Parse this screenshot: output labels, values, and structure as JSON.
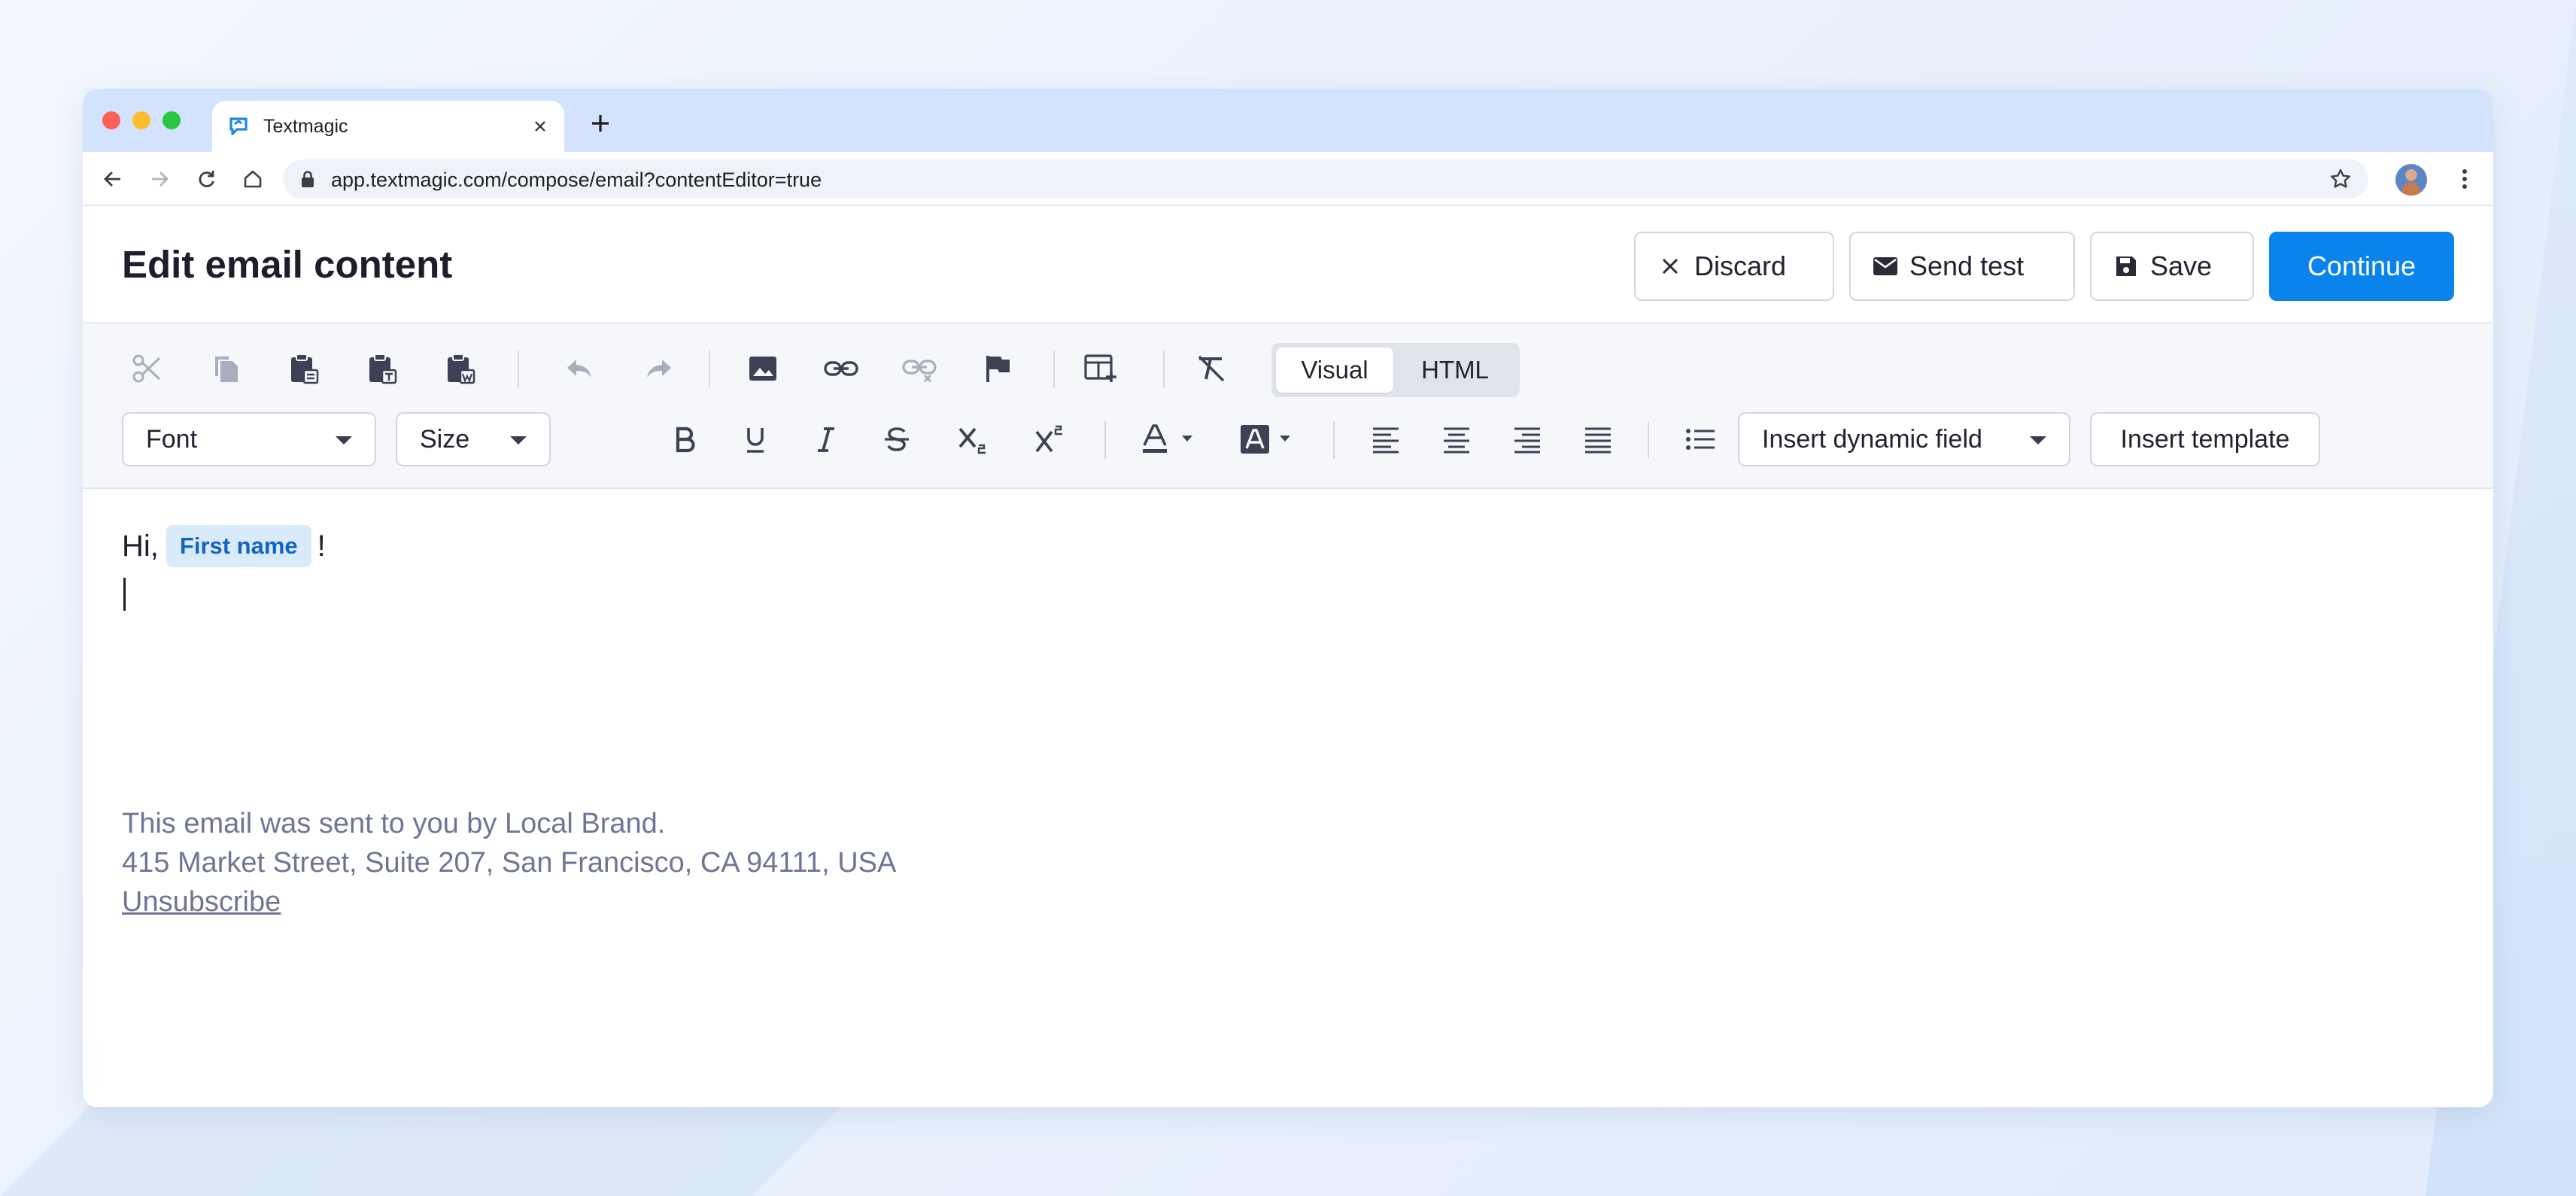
{
  "browser": {
    "tab_title": "Textmagic",
    "url": "app.textmagic.com/compose/email?contentEditor=true"
  },
  "header": {
    "title": "Edit email content",
    "discard_label": "Discard",
    "send_test_label": "Send test",
    "save_label": "Save",
    "continue_label": "Continue"
  },
  "toolbar": {
    "mode_visual": "Visual",
    "mode_html": "HTML",
    "font_select": "Font",
    "size_select": "Size",
    "dynamic_field_select": "Insert dynamic field",
    "insert_template_label": "Insert template",
    "icons_row1": [
      "cut-icon",
      "copy-icon",
      "paste-icon",
      "paste-text-icon",
      "paste-word-icon",
      "undo-icon",
      "redo-icon",
      "image-icon",
      "link-icon",
      "unlink-icon",
      "anchor-flag-icon",
      "insert-table-icon",
      "clear-format-icon"
    ],
    "icons_row2": [
      "bold-icon",
      "underline-icon",
      "italic-icon",
      "strikethrough-icon",
      "subscript-icon",
      "superscript-icon",
      "text-color-icon",
      "background-color-icon",
      "align-left-icon",
      "align-center-icon",
      "align-right-icon",
      "align-justify-icon",
      "bullet-list-icon",
      "numbered-list-icon"
    ]
  },
  "content": {
    "greeting_prefix": "Hi,",
    "dynamic_field_chip": "First name",
    "greeting_suffix": "!",
    "footer_line1": "This email was sent to you by Local Brand.",
    "footer_line2": "415 Market Street, Suite 207, San Francisco, CA 94111, USA",
    "unsubscribe": "Unsubscribe"
  },
  "colors": {
    "accent": "#0a84ec",
    "chip_bg": "#d9ebfa",
    "chip_text": "#1565c0",
    "footer_text": "#6f7596"
  }
}
